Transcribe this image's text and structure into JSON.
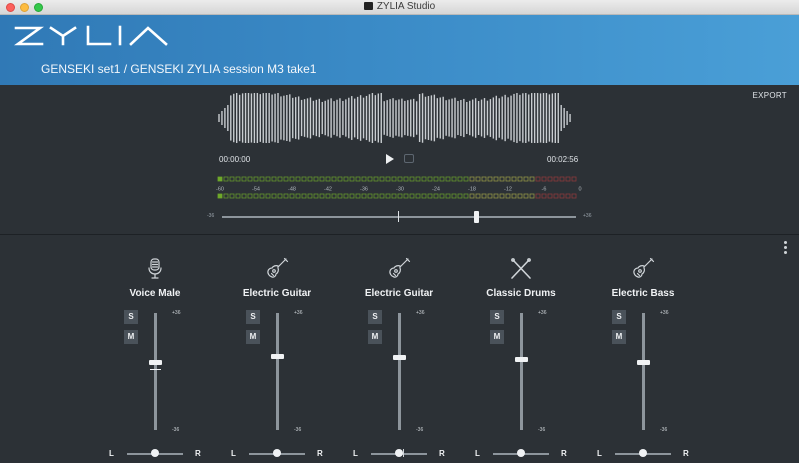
{
  "window": {
    "title": "ZYLIA Studio"
  },
  "header": {
    "logo_text": "ZYLIA",
    "breadcrumb": "GENSEKI set1 / GENSEKI ZYLIA session M3 take1"
  },
  "transport": {
    "export_label": "EXPORT",
    "time_start": "00:00:00",
    "time_end": "00:02:56",
    "play_icon": "play-icon",
    "loop_icon": "loop-icon",
    "meter_scale": [
      "-60",
      "-54",
      "-48",
      "-42",
      "-36",
      "-30",
      "-24",
      "-18",
      "-12",
      "-6",
      "0"
    ],
    "meter_colors": {
      "green": "#6fa82a",
      "yellow": "#a3a64a",
      "red": "#9b3b3b"
    },
    "scrub_min": "-36",
    "scrub_max": "+36",
    "scrub_position": 0.72
  },
  "mixer": {
    "menu_icon": "more-vertical-icon",
    "channels": [
      {
        "name": "Voice Male",
        "icon": "microphone-icon",
        "solo": "S",
        "mute": "M",
        "max": "+36",
        "min": "-36",
        "fader_level": 0.42,
        "pan_l": "L",
        "pan_r": "R",
        "pan": 0.0
      },
      {
        "name": "Electric Guitar",
        "icon": "guitar-icon",
        "solo": "S",
        "mute": "M",
        "max": "+36",
        "min": "-36",
        "fader_level": 0.37,
        "pan_l": "L",
        "pan_r": "R",
        "pan": 0.0
      },
      {
        "name": "Electric Guitar",
        "icon": "guitar-icon",
        "solo": "S",
        "mute": "M",
        "max": "+36",
        "min": "-36",
        "fader_level": 0.38,
        "pan_l": "L",
        "pan_r": "R",
        "pan": 0.0
      },
      {
        "name": "Classic Drums",
        "icon": "drumsticks-icon",
        "solo": "S",
        "mute": "M",
        "max": "+36",
        "min": "-36",
        "fader_level": 0.39,
        "pan_l": "L",
        "pan_r": "R",
        "pan": 0.0
      },
      {
        "name": "Electric Bass",
        "icon": "bass-guitar-icon",
        "solo": "S",
        "mute": "M",
        "max": "+36",
        "min": "-36",
        "fader_level": 0.42,
        "pan_l": "L",
        "pan_r": "R",
        "pan": 0.0
      }
    ]
  }
}
